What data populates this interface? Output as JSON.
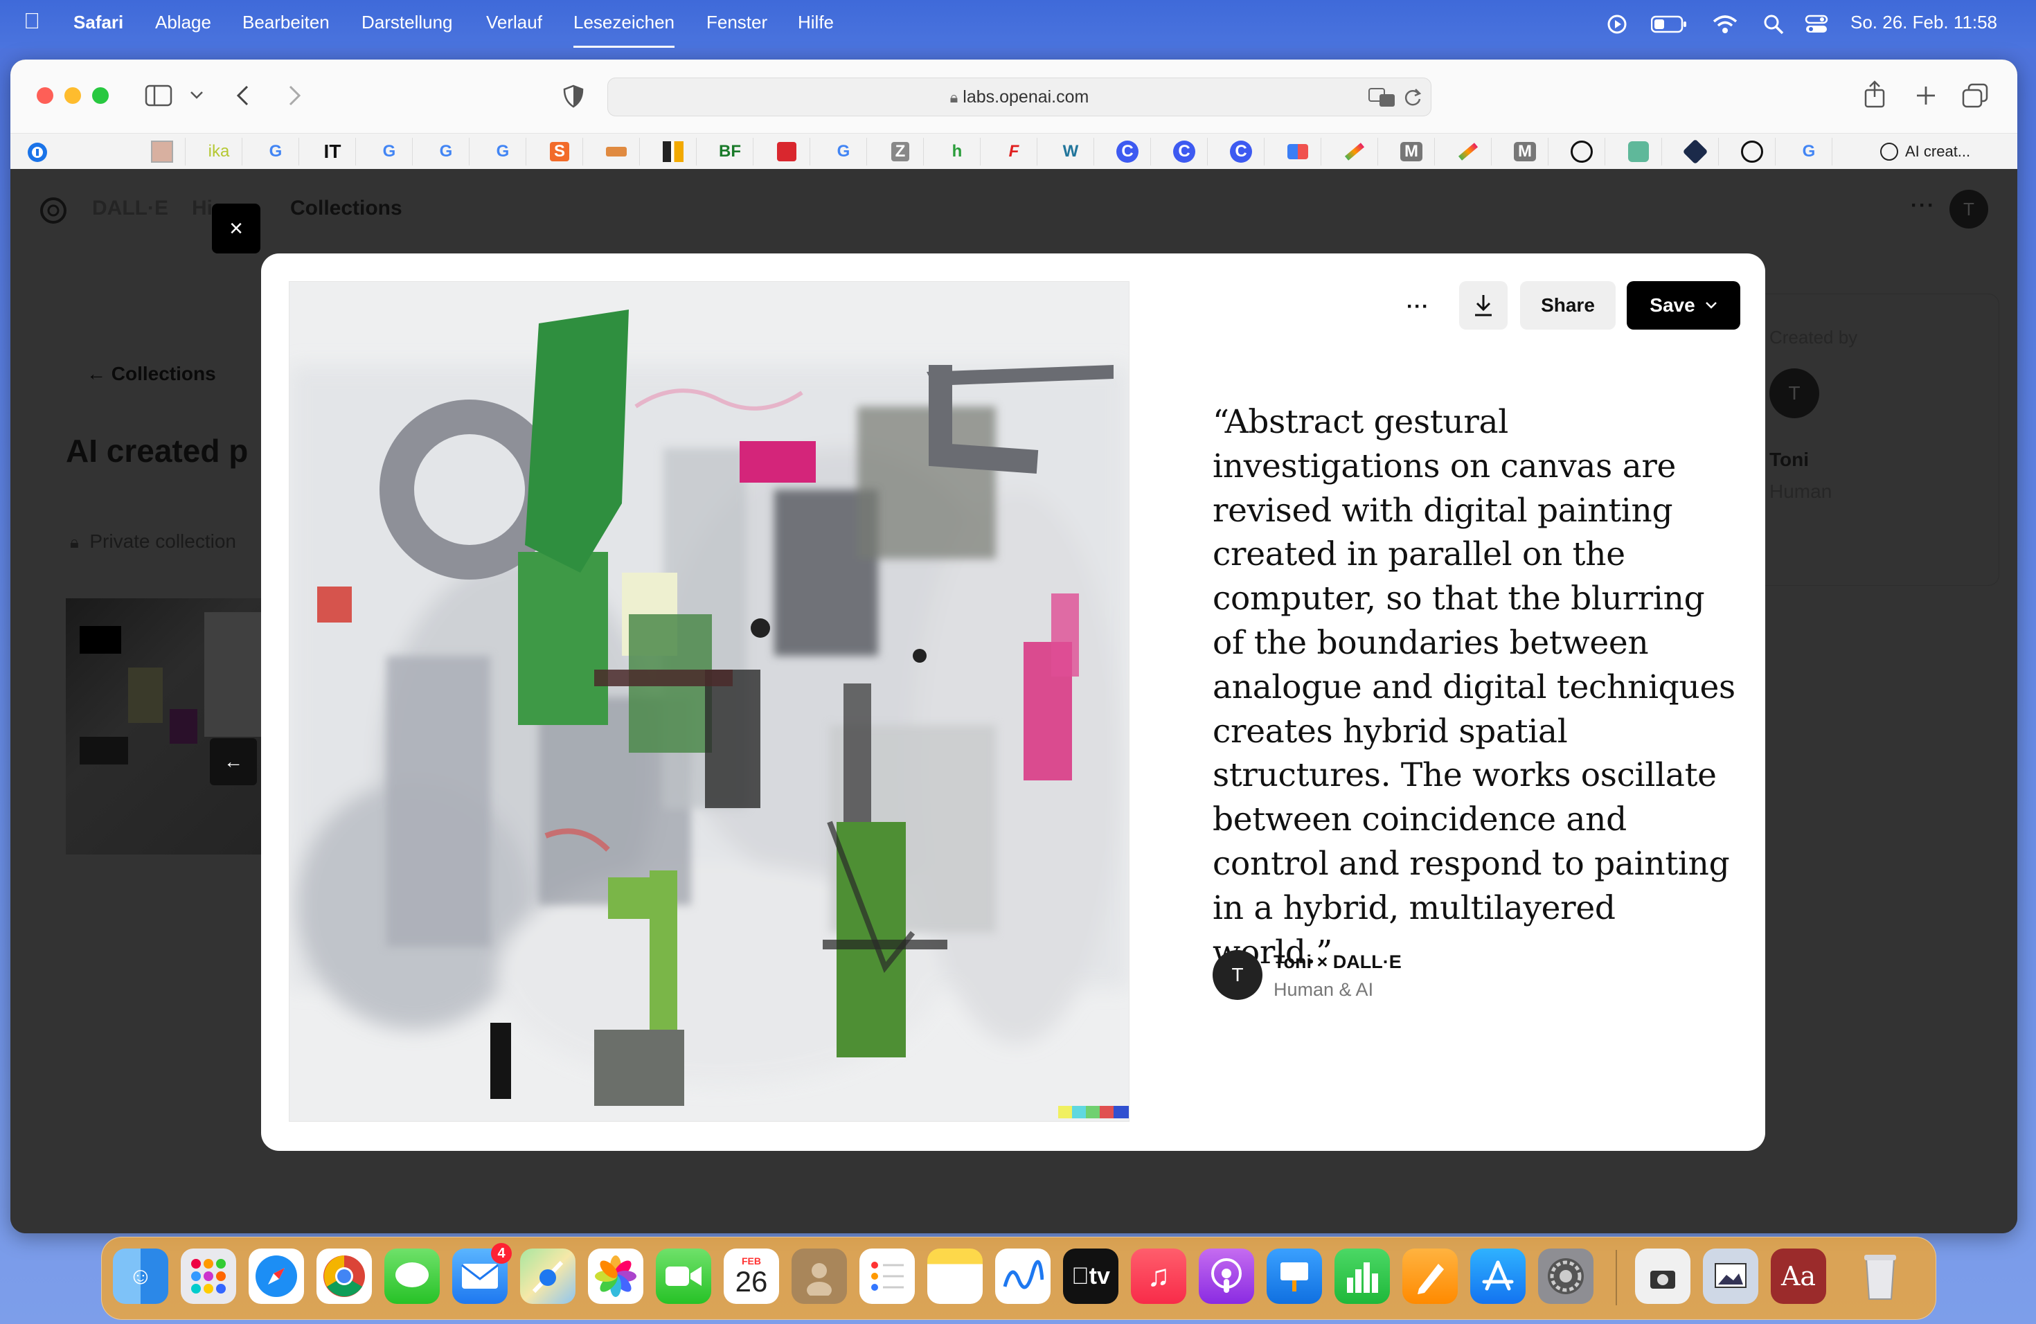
{
  "menubar": {
    "app": "Safari",
    "items": [
      "Ablage",
      "Bearbeiten",
      "Darstellung",
      "Verlauf",
      "Lesezeichen",
      "Fenster",
      "Hilfe"
    ],
    "datetime": "So. 26. Feb.  11:58"
  },
  "browser": {
    "url": "labs.openai.com",
    "active_tab_title": "AI creat..."
  },
  "bookmarks": [
    "",
    "ika",
    "G",
    "IT",
    "G",
    "G",
    "G",
    "S",
    "",
    "",
    "BF",
    "",
    "G",
    "Z",
    "h",
    "F",
    "W",
    "C",
    "C",
    "C",
    "",
    "",
    "M",
    "",
    "M",
    "",
    "",
    "",
    "",
    ""
  ],
  "page_behind": {
    "brand": "DALL·E",
    "nav_partial": "Hi",
    "nav_collections": "Collections",
    "back_link": "Collections",
    "title_partial": "AI created p",
    "privacy_partial": "Private collection",
    "created_by_label": "Created by",
    "creator_name": "Toni",
    "creator_type": "Human",
    "avatar_initial": "T"
  },
  "modal": {
    "close_symbol": "×",
    "more_symbol": "···",
    "share_label": "Share",
    "save_label": "Save",
    "quote": "“Abstract gestural investigations on canvas are revised with digital painting created in parallel on the computer, so that the blurring of the boundaries between analogue and digital techniques creates hybrid spatial structures. The works oscillate between coincidence and control and respond to painting in a hybrid, multilayered world.”",
    "author_initial": "T",
    "author_name": "Toni × DALL·E",
    "author_type": "Human & AI",
    "prev_arrow": "←"
  },
  "dock": {
    "mail_badge": "4",
    "calendar_month": "FEB",
    "calendar_day": "26",
    "tv_label": "tv",
    "dictionary_label": "Aa"
  },
  "colors": {
    "accent_black": "#000000",
    "menubar_blue": "#3f6ad9",
    "dock_orange": "#eba53c"
  }
}
